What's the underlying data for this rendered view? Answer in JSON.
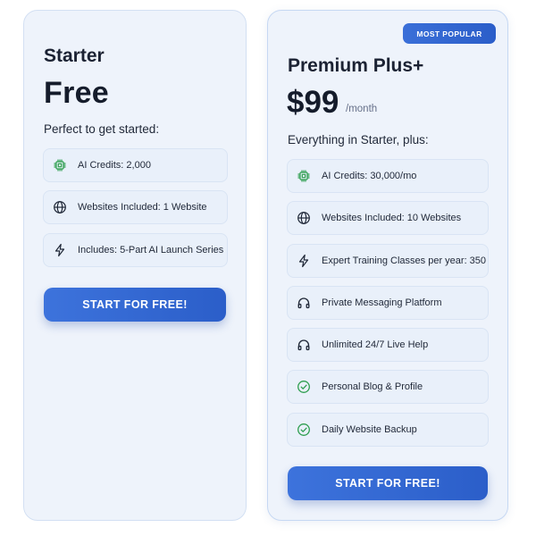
{
  "colors": {
    "card_bg": "#eef3fb",
    "feature_bg": "#e9f0fa",
    "accent": "#2f63cf",
    "chip_green": "#2e9e4f",
    "check_green": "#2e9e4f",
    "text_dark": "#1b2233"
  },
  "starter": {
    "name": "Starter",
    "price": "Free",
    "subtitle": "Perfect to get started:",
    "features": [
      {
        "icon": "chip-icon",
        "label": "AI Credits: 2,000"
      },
      {
        "icon": "globe-icon",
        "label": "Websites Included: 1 Website"
      },
      {
        "icon": "lightning-icon",
        "label": "Includes: 5-Part AI Launch Series"
      }
    ],
    "cta_label": "START FOR FREE!"
  },
  "premium": {
    "badge": "MOST POPULAR",
    "name": "Premium Plus+",
    "price": "$99",
    "period": "/month",
    "subtitle": "Everything in Starter, plus:",
    "features": [
      {
        "icon": "chip-icon",
        "label": "AI Credits: 30,000/mo"
      },
      {
        "icon": "globe-icon",
        "label": "Websites Included: 10 Websites"
      },
      {
        "icon": "lightning-icon",
        "label": "Expert Training Classes per year: 350"
      },
      {
        "icon": "headphones-icon",
        "label": "Private Messaging Platform"
      },
      {
        "icon": "headphones-icon",
        "label": "Unlimited 24/7 Live Help"
      },
      {
        "icon": "check-circle-icon",
        "label": "Personal Blog & Profile"
      },
      {
        "icon": "check-circle-icon",
        "label": "Daily Website Backup"
      }
    ],
    "cta_label": "START FOR FREE!"
  }
}
